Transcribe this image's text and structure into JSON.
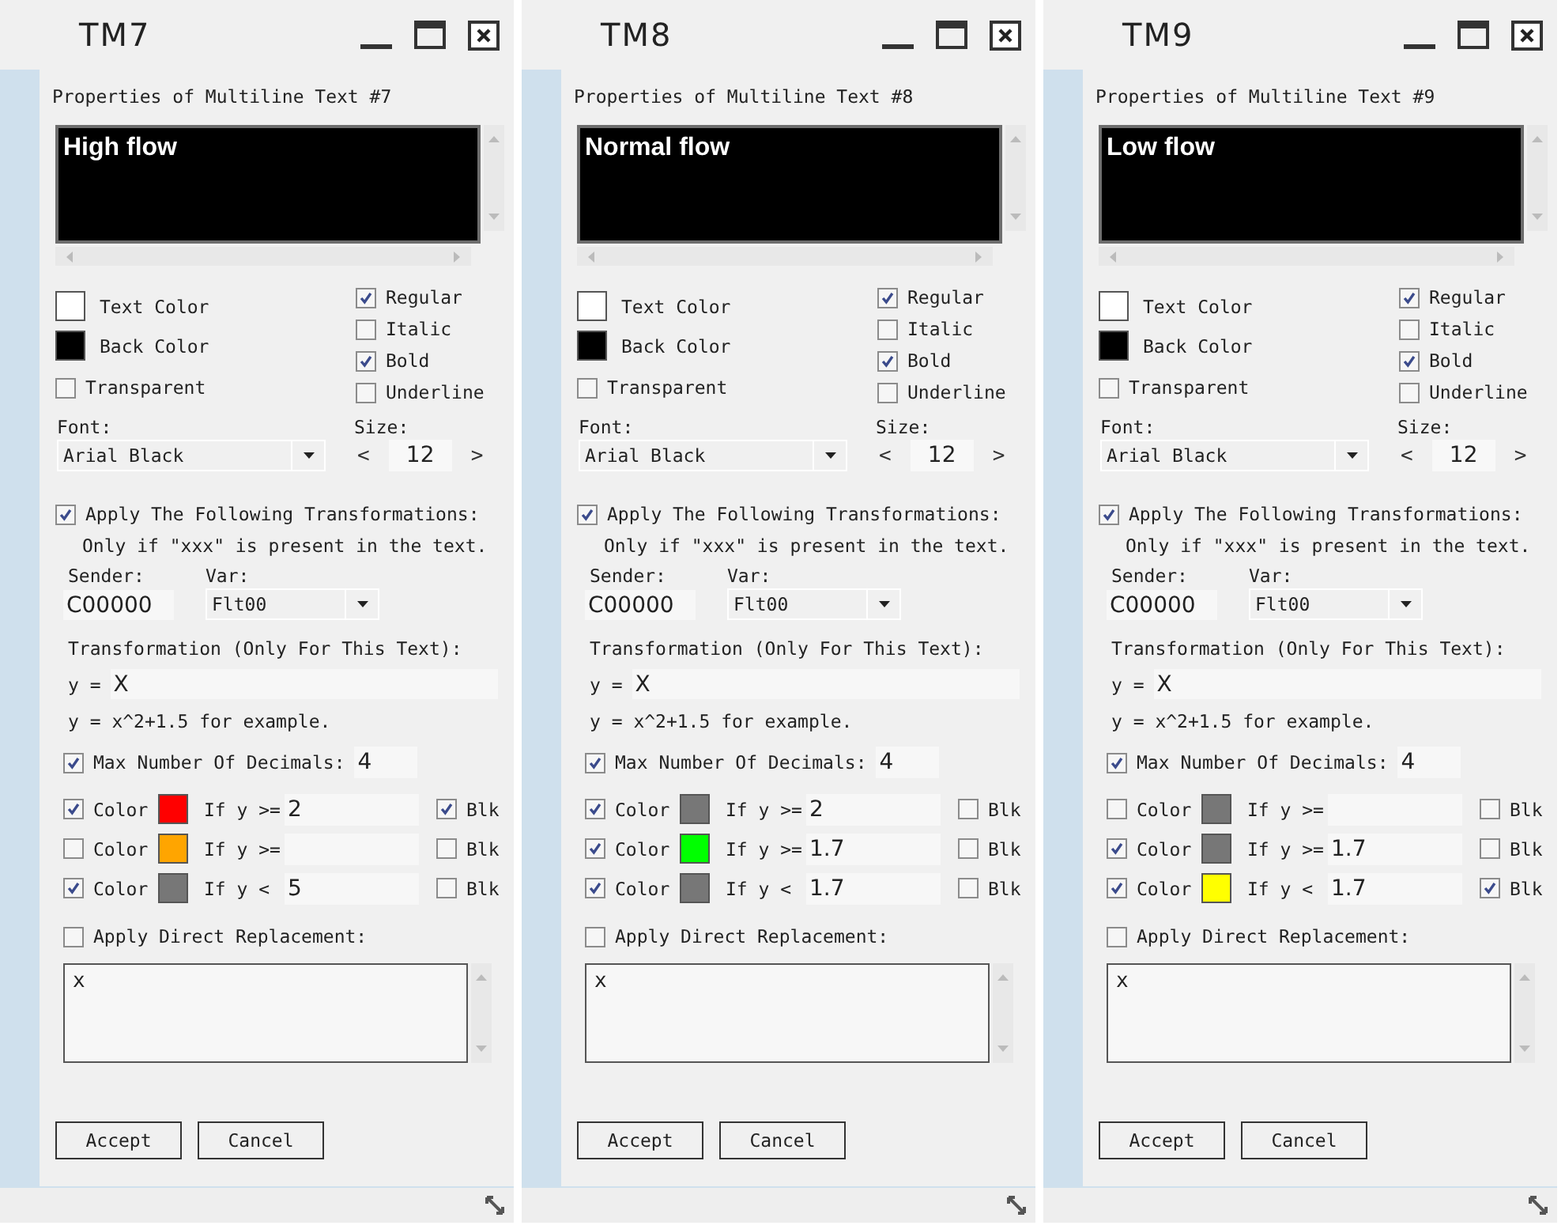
{
  "windows": [
    {
      "title": "TM7",
      "heading": "Properties of Multiline Text #7",
      "preview": {
        "text": "High flow"
      },
      "text_color": {
        "label": "Text Color",
        "color": "#ffffff"
      },
      "back_color": {
        "label": "Back Color",
        "color": "#000000"
      },
      "styles": [
        {
          "label": "Regular",
          "checked": true
        },
        {
          "label": "Italic",
          "checked": false
        },
        {
          "label": "Bold",
          "checked": true
        },
        {
          "label": "Underline",
          "checked": false
        }
      ],
      "transparent": {
        "label": "Transparent",
        "checked": false
      },
      "font": {
        "label": "Font:",
        "value": "Arial Black"
      },
      "size": {
        "label": "Size:",
        "value": "12",
        "prev": "<",
        "next": ">"
      },
      "transform": {
        "label": "Apply The Following Transformations:",
        "checked": true,
        "note": "Only if \"xxx\" is present in the text.",
        "sender_label": "Sender:",
        "sender": "C00000",
        "var_label": "Var:",
        "var": "Flt00",
        "formula_label": "Transformation (Only For This Text):",
        "formula_prefix": "y =",
        "formula": "X",
        "example": "y = x^2+1.5 for example."
      },
      "decimals": {
        "label": "Max Number Of Decimals:",
        "checked": true,
        "value": "4"
      },
      "color_rules": [
        {
          "checked": true,
          "label": "Color",
          "color": "#ff0000",
          "condition": "If y >=",
          "value": "2",
          "blk_label": "Blk",
          "blk": true
        },
        {
          "checked": false,
          "label": "Color",
          "color": "#ffa500",
          "condition": "If y >=",
          "blk_label": "Blk",
          "blk": false
        },
        {
          "checked": true,
          "label": "Color",
          "color": "#777777",
          "condition": "If y <",
          "value": "5",
          "blk_label": "Blk",
          "blk": false
        }
      ],
      "direct": {
        "label": "Apply Direct Replacement:",
        "checked": false,
        "value": "x"
      },
      "buttons": [
        "Accept",
        "Cancel"
      ]
    },
    {
      "title": "TM8",
      "heading": "Properties of Multiline Text #8",
      "preview": {
        "text": "Normal flow"
      },
      "text_color": {
        "label": "Text Color",
        "color": "#ffffff"
      },
      "back_color": {
        "label": "Back Color",
        "color": "#000000"
      },
      "styles": [
        {
          "label": "Regular",
          "checked": true
        },
        {
          "label": "Italic",
          "checked": false
        },
        {
          "label": "Bold",
          "checked": true
        },
        {
          "label": "Underline",
          "checked": false
        }
      ],
      "transparent": {
        "label": "Transparent",
        "checked": false
      },
      "font": {
        "label": "Font:",
        "value": "Arial Black"
      },
      "size": {
        "label": "Size:",
        "value": "12",
        "prev": "<",
        "next": ">"
      },
      "transform": {
        "label": "Apply The Following Transformations:",
        "checked": true,
        "note": "Only if \"xxx\" is present in the text.",
        "sender_label": "Sender:",
        "sender": "C00000",
        "var_label": "Var:",
        "var": "Flt00",
        "formula_label": "Transformation (Only For This Text):",
        "formula_prefix": "y =",
        "formula": "X",
        "example": "y = x^2+1.5 for example."
      },
      "decimals": {
        "label": "Max Number Of Decimals:",
        "checked": true,
        "value": "4"
      },
      "color_rules": [
        {
          "checked": true,
          "label": "Color",
          "color": "#777777",
          "condition": "If y >=",
          "value": "2",
          "blk_label": "Blk",
          "blk": false
        },
        {
          "checked": true,
          "label": "Color",
          "color": "#00ff00",
          "condition": "If y >=",
          "value": "1.7",
          "blk_label": "Blk",
          "blk": false
        },
        {
          "checked": true,
          "label": "Color",
          "color": "#777777",
          "condition": "If y <",
          "value": "1.7",
          "blk_label": "Blk",
          "blk": false
        }
      ],
      "direct": {
        "label": "Apply Direct Replacement:",
        "checked": false,
        "value": "x"
      },
      "buttons": [
        "Accept",
        "Cancel"
      ]
    },
    {
      "title": "TM9",
      "heading": "Properties of Multiline Text #9",
      "preview": {
        "text": "Low flow"
      },
      "text_color": {
        "label": "Text Color",
        "color": "#ffffff"
      },
      "back_color": {
        "label": "Back Color",
        "color": "#000000"
      },
      "styles": [
        {
          "label": "Regular",
          "checked": true
        },
        {
          "label": "Italic",
          "checked": false
        },
        {
          "label": "Bold",
          "checked": true
        },
        {
          "label": "Underline",
          "checked": false
        }
      ],
      "transparent": {
        "label": "Transparent",
        "checked": false
      },
      "font": {
        "label": "Font:",
        "value": "Arial Black"
      },
      "size": {
        "label": "Size:",
        "value": "12",
        "prev": "<",
        "next": ">"
      },
      "transform": {
        "label": "Apply The Following Transformations:",
        "checked": true,
        "note": "Only if \"xxx\" is present in the text.",
        "sender_label": "Sender:",
        "sender": "C00000",
        "var_label": "Var:",
        "var": "Flt00",
        "formula_label": "Transformation (Only For This Text):",
        "formula_prefix": "y =",
        "formula": "X",
        "example": "y = x^2+1.5 for example."
      },
      "decimals": {
        "label": "Max Number Of Decimals:",
        "checked": true,
        "value": "4"
      },
      "color_rules": [
        {
          "checked": false,
          "label": "Color",
          "color": "#777777",
          "condition": "If y >=",
          "blk_label": "Blk",
          "blk": false
        },
        {
          "checked": true,
          "label": "Color",
          "color": "#777777",
          "condition": "If y >=",
          "value": "1.7",
          "blk_label": "Blk",
          "blk": false
        },
        {
          "checked": true,
          "label": "Color",
          "color": "#ffff00",
          "condition": "If y <",
          "value": "1.7",
          "blk_label": "Blk",
          "blk": true
        }
      ],
      "direct": {
        "label": "Apply Direct Replacement:",
        "checked": false,
        "value": "x"
      },
      "buttons": [
        "Accept",
        "Cancel"
      ]
    }
  ]
}
